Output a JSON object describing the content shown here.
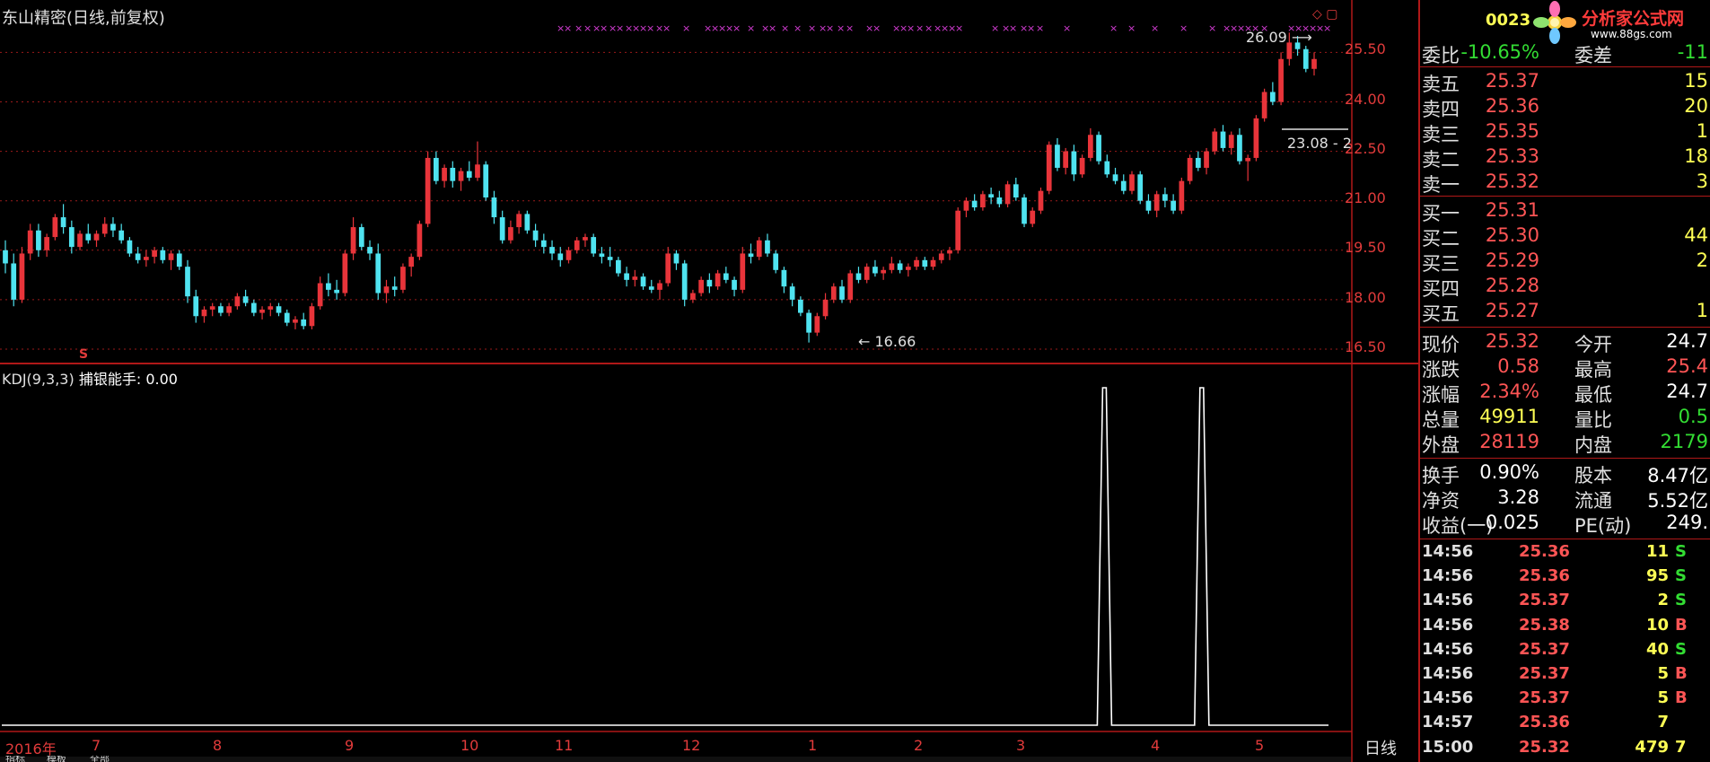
{
  "header": {
    "title": "东山精密(日线,前复权)",
    "code": "0023",
    "logo_text": "分析家公式网",
    "logo_url": "www.88gs.com"
  },
  "indicator": {
    "name": "KDJ(9,3,3)",
    "label": "捕银能手:",
    "value": "0.00"
  },
  "axis": {
    "price_ticks": [
      "25.50",
      "24.00",
      "22.50",
      "21.00",
      "19.50",
      "18.00",
      "16.50"
    ],
    "year": "2016年",
    "months": [
      "7",
      "8",
      "9",
      "10",
      "11",
      "12",
      "1",
      "2",
      "3",
      "4",
      "5"
    ],
    "period_label": "日线"
  },
  "annotations": {
    "high": "26.09",
    "low": "16.66",
    "range": "23.08 - 2",
    "signal_marker": "S"
  },
  "bottom_tabs": [
    "指标",
    "模板",
    "全部"
  ],
  "order_book": {
    "ratio": {
      "label": "委比",
      "value": "-10.65%",
      "label2": "委差",
      "value2": "-11"
    },
    "asks": [
      {
        "label": "卖五",
        "price": "25.37",
        "vol": "15"
      },
      {
        "label": "卖四",
        "price": "25.36",
        "vol": "20"
      },
      {
        "label": "卖三",
        "price": "25.35",
        "vol": "1"
      },
      {
        "label": "卖二",
        "price": "25.33",
        "vol": "18"
      },
      {
        "label": "卖一",
        "price": "25.32",
        "vol": "3"
      }
    ],
    "bids": [
      {
        "label": "买一",
        "price": "25.31",
        "vol": ""
      },
      {
        "label": "买二",
        "price": "25.30",
        "vol": "44"
      },
      {
        "label": "买三",
        "price": "25.29",
        "vol": "2"
      },
      {
        "label": "买四",
        "price": "25.28",
        "vol": ""
      },
      {
        "label": "买五",
        "price": "25.27",
        "vol": "1"
      }
    ]
  },
  "quote": [
    {
      "l1": "现价",
      "v1": "25.32",
      "l2": "今开",
      "v2": "24.7"
    },
    {
      "l1": "涨跌",
      "v1": "0.58",
      "l2": "最高",
      "v2": "25.4"
    },
    {
      "l1": "涨幅",
      "v1": "2.34%",
      "l2": "最低",
      "v2": "24.7"
    },
    {
      "l1": "总量",
      "v1": "49911",
      "l2": "量比",
      "v2": "0.5"
    },
    {
      "l1": "外盘",
      "v1": "28119",
      "l2": "内盘",
      "v2": "2179"
    }
  ],
  "fundamentals": [
    {
      "l1": "换手",
      "v1": "0.90%",
      "l2": "股本",
      "v2": "8.47亿"
    },
    {
      "l1": "净资",
      "v1": "3.28",
      "l2": "流通",
      "v2": "5.52亿"
    },
    {
      "l1": "收益(一)",
      "v1": "0.025",
      "l2": "PE(动)",
      "v2": "249."
    }
  ],
  "ticks": [
    {
      "time": "14:56",
      "price": "25.36",
      "vol": "11",
      "side": "S"
    },
    {
      "time": "14:56",
      "price": "25.36",
      "vol": "95",
      "side": "S"
    },
    {
      "time": "14:56",
      "price": "25.37",
      "vol": "2",
      "side": "S"
    },
    {
      "time": "14:56",
      "price": "25.38",
      "vol": "10",
      "side": "B"
    },
    {
      "time": "14:56",
      "price": "25.37",
      "vol": "40",
      "side": "S"
    },
    {
      "time": "14:56",
      "price": "25.37",
      "vol": "5",
      "side": "B"
    },
    {
      "time": "14:56",
      "price": "25.37",
      "vol": "5",
      "side": "B"
    },
    {
      "time": "14:57",
      "price": "25.36",
      "vol": "7",
      "side": ""
    },
    {
      "time": "15:00",
      "price": "25.32",
      "vol": "479",
      "side": "7"
    }
  ],
  "colors": {
    "up": "#e8343a",
    "down": "#4fe3f0",
    "grid": "#b01818",
    "text": "#e0e0e0",
    "marker": "#d43cd4"
  },
  "chart_data": {
    "type": "candlestick",
    "ylim": [
      16.2,
      26.6
    ],
    "ohlc": [
      [
        19.5,
        19.8,
        18.8,
        19.1
      ],
      [
        19.1,
        19.4,
        17.8,
        18.0
      ],
      [
        18.0,
        19.6,
        17.9,
        19.4
      ],
      [
        19.4,
        20.3,
        19.2,
        20.1
      ],
      [
        20.1,
        20.3,
        19.3,
        19.5
      ],
      [
        19.5,
        20.0,
        19.3,
        19.9
      ],
      [
        19.9,
        20.6,
        19.8,
        20.5
      ],
      [
        20.5,
        20.9,
        20.0,
        20.2
      ],
      [
        20.2,
        20.4,
        19.4,
        19.6
      ],
      [
        19.6,
        20.1,
        19.5,
        20.0
      ],
      [
        20.0,
        20.3,
        19.7,
        19.8
      ],
      [
        19.8,
        20.1,
        19.6,
        20.0
      ],
      [
        20.0,
        20.5,
        19.9,
        20.3
      ],
      [
        20.3,
        20.5,
        19.9,
        20.1
      ],
      [
        20.1,
        20.3,
        19.7,
        19.8
      ],
      [
        19.8,
        19.9,
        19.3,
        19.4
      ],
      [
        19.4,
        19.6,
        19.1,
        19.2
      ],
      [
        19.2,
        19.5,
        19.0,
        19.3
      ],
      [
        19.3,
        19.6,
        19.1,
        19.5
      ],
      [
        19.5,
        19.6,
        19.1,
        19.2
      ],
      [
        19.2,
        19.5,
        18.9,
        19.4
      ],
      [
        19.4,
        19.5,
        18.9,
        19.0
      ],
      [
        19.0,
        19.2,
        17.9,
        18.1
      ],
      [
        18.1,
        18.3,
        17.3,
        17.5
      ],
      [
        17.5,
        17.8,
        17.3,
        17.7
      ],
      [
        17.7,
        17.9,
        17.5,
        17.8
      ],
      [
        17.8,
        17.9,
        17.5,
        17.6
      ],
      [
        17.6,
        17.9,
        17.5,
        17.8
      ],
      [
        17.8,
        18.2,
        17.7,
        18.1
      ],
      [
        18.1,
        18.3,
        17.8,
        17.9
      ],
      [
        17.9,
        18.0,
        17.5,
        17.6
      ],
      [
        17.6,
        17.8,
        17.4,
        17.7
      ],
      [
        17.7,
        17.9,
        17.5,
        17.8
      ],
      [
        17.8,
        17.9,
        17.5,
        17.6
      ],
      [
        17.6,
        17.7,
        17.2,
        17.3
      ],
      [
        17.3,
        17.5,
        17.1,
        17.4
      ],
      [
        17.4,
        17.6,
        17.1,
        17.2
      ],
      [
        17.2,
        17.9,
        17.1,
        17.8
      ],
      [
        17.8,
        18.7,
        17.7,
        18.5
      ],
      [
        18.5,
        18.8,
        18.1,
        18.3
      ],
      [
        18.3,
        18.6,
        18.0,
        18.2
      ],
      [
        18.2,
        19.5,
        18.1,
        19.4
      ],
      [
        19.4,
        20.5,
        19.2,
        20.2
      ],
      [
        20.2,
        20.3,
        19.5,
        19.6
      ],
      [
        19.6,
        19.8,
        19.2,
        19.4
      ],
      [
        19.4,
        19.7,
        18.0,
        18.2
      ],
      [
        18.2,
        18.6,
        17.9,
        18.4
      ],
      [
        18.4,
        18.7,
        18.1,
        18.3
      ],
      [
        18.3,
        19.1,
        18.2,
        19.0
      ],
      [
        19.0,
        19.4,
        18.7,
        19.3
      ],
      [
        19.3,
        20.4,
        19.2,
        20.3
      ],
      [
        20.3,
        22.5,
        20.2,
        22.3
      ],
      [
        22.3,
        22.5,
        21.5,
        21.6
      ],
      [
        21.6,
        22.1,
        21.4,
        22.0
      ],
      [
        22.0,
        22.2,
        21.4,
        21.6
      ],
      [
        21.6,
        22.0,
        21.3,
        21.9
      ],
      [
        21.9,
        22.2,
        21.6,
        21.7
      ],
      [
        21.7,
        22.8,
        21.6,
        22.1
      ],
      [
        22.1,
        22.2,
        21.0,
        21.1
      ],
      [
        21.1,
        21.3,
        20.3,
        20.5
      ],
      [
        20.5,
        20.7,
        19.7,
        19.8
      ],
      [
        19.8,
        20.4,
        19.7,
        20.2
      ],
      [
        20.2,
        20.7,
        20.0,
        20.6
      ],
      [
        20.6,
        20.7,
        20.0,
        20.1
      ],
      [
        20.1,
        20.3,
        19.6,
        19.8
      ],
      [
        19.8,
        20.0,
        19.4,
        19.6
      ],
      [
        19.6,
        19.8,
        19.2,
        19.4
      ],
      [
        19.4,
        19.6,
        19.0,
        19.2
      ],
      [
        19.2,
        19.6,
        19.1,
        19.5
      ],
      [
        19.5,
        19.9,
        19.4,
        19.8
      ],
      [
        19.8,
        20.0,
        19.6,
        19.9
      ],
      [
        19.9,
        20.0,
        19.3,
        19.4
      ],
      [
        19.4,
        19.6,
        19.1,
        19.3
      ],
      [
        19.3,
        19.6,
        19.0,
        19.2
      ],
      [
        19.2,
        19.3,
        18.7,
        18.8
      ],
      [
        18.8,
        19.0,
        18.4,
        18.6
      ],
      [
        18.6,
        18.9,
        18.4,
        18.7
      ],
      [
        18.7,
        18.8,
        18.3,
        18.4
      ],
      [
        18.4,
        18.6,
        18.2,
        18.3
      ],
      [
        18.3,
        18.6,
        18.0,
        18.5
      ],
      [
        18.5,
        19.6,
        18.4,
        19.4
      ],
      [
        19.4,
        19.5,
        18.9,
        19.1
      ],
      [
        19.1,
        19.2,
        17.8,
        18.0
      ],
      [
        18.0,
        18.3,
        17.9,
        18.2
      ],
      [
        18.2,
        18.7,
        18.1,
        18.6
      ],
      [
        18.6,
        18.8,
        18.2,
        18.4
      ],
      [
        18.4,
        18.9,
        18.3,
        18.8
      ],
      [
        18.8,
        19.0,
        18.5,
        18.6
      ],
      [
        18.6,
        18.7,
        18.1,
        18.3
      ],
      [
        18.3,
        19.6,
        18.2,
        19.4
      ],
      [
        19.4,
        19.7,
        19.1,
        19.3
      ],
      [
        19.3,
        19.9,
        19.2,
        19.8
      ],
      [
        19.8,
        20.0,
        19.3,
        19.4
      ],
      [
        19.4,
        19.5,
        18.8,
        18.9
      ],
      [
        18.9,
        19.0,
        18.2,
        18.4
      ],
      [
        18.4,
        18.5,
        17.8,
        18.0
      ],
      [
        18.0,
        18.1,
        17.5,
        17.6
      ],
      [
        17.6,
        17.7,
        16.7,
        17.0
      ],
      [
        17.0,
        17.6,
        16.9,
        17.5
      ],
      [
        17.5,
        18.2,
        17.4,
        18.0
      ],
      [
        18.0,
        18.5,
        17.9,
        18.4
      ],
      [
        18.4,
        18.6,
        17.9,
        18.0
      ],
      [
        18.0,
        18.9,
        17.9,
        18.8
      ],
      [
        18.8,
        19.0,
        18.5,
        18.6
      ],
      [
        18.6,
        19.1,
        18.5,
        19.0
      ],
      [
        19.0,
        19.2,
        18.7,
        18.8
      ],
      [
        18.8,
        19.0,
        18.6,
        18.9
      ],
      [
        18.9,
        19.3,
        18.8,
        19.1
      ],
      [
        19.1,
        19.2,
        18.8,
        18.9
      ],
      [
        18.9,
        19.1,
        18.7,
        19.0
      ],
      [
        19.0,
        19.3,
        18.9,
        19.2
      ],
      [
        19.2,
        19.3,
        18.9,
        19.0
      ],
      [
        19.0,
        19.3,
        18.9,
        19.2
      ],
      [
        19.2,
        19.5,
        19.1,
        19.4
      ],
      [
        19.4,
        19.6,
        19.2,
        19.5
      ],
      [
        19.5,
        20.8,
        19.4,
        20.7
      ],
      [
        20.7,
        21.1,
        20.5,
        21.0
      ],
      [
        21.0,
        21.2,
        20.7,
        20.8
      ],
      [
        20.8,
        21.3,
        20.7,
        21.2
      ],
      [
        21.2,
        21.4,
        20.9,
        21.1
      ],
      [
        21.1,
        21.3,
        20.8,
        20.9
      ],
      [
        20.9,
        21.6,
        20.8,
        21.5
      ],
      [
        21.5,
        21.7,
        21.0,
        21.1
      ],
      [
        21.1,
        21.2,
        20.2,
        20.3
      ],
      [
        20.3,
        20.8,
        20.2,
        20.7
      ],
      [
        20.7,
        21.4,
        20.6,
        21.3
      ],
      [
        21.3,
        22.8,
        21.2,
        22.7
      ],
      [
        22.7,
        22.9,
        21.9,
        22.0
      ],
      [
        22.0,
        22.6,
        21.8,
        22.5
      ],
      [
        22.5,
        22.7,
        21.6,
        21.8
      ],
      [
        21.8,
        22.4,
        21.7,
        22.3
      ],
      [
        22.3,
        23.2,
        22.2,
        23.0
      ],
      [
        23.0,
        23.1,
        22.1,
        22.2
      ],
      [
        22.2,
        22.4,
        21.7,
        21.8
      ],
      [
        21.8,
        22.0,
        21.5,
        21.6
      ],
      [
        21.6,
        21.8,
        21.2,
        21.3
      ],
      [
        21.3,
        21.9,
        21.2,
        21.8
      ],
      [
        21.8,
        21.9,
        20.9,
        21.0
      ],
      [
        21.0,
        21.2,
        20.6,
        20.7
      ],
      [
        20.7,
        21.3,
        20.5,
        21.2
      ],
      [
        21.2,
        21.4,
        20.8,
        21.0
      ],
      [
        21.0,
        21.2,
        20.6,
        20.7
      ],
      [
        20.7,
        21.7,
        20.6,
        21.6
      ],
      [
        21.6,
        22.4,
        21.5,
        22.3
      ],
      [
        22.3,
        22.5,
        21.9,
        22.0
      ],
      [
        22.0,
        22.6,
        21.8,
        22.5
      ],
      [
        22.5,
        23.2,
        22.4,
        23.1
      ],
      [
        23.1,
        23.3,
        22.5,
        22.6
      ],
      [
        22.6,
        23.1,
        22.4,
        23.0
      ],
      [
        23.0,
        23.2,
        22.1,
        22.2
      ],
      [
        22.2,
        22.4,
        21.6,
        22.3
      ],
      [
        22.3,
        23.6,
        22.2,
        23.5
      ],
      [
        23.5,
        24.4,
        23.4,
        24.3
      ],
      [
        24.3,
        24.6,
        23.9,
        24.0
      ],
      [
        24.0,
        25.5,
        23.9,
        25.3
      ],
      [
        25.3,
        26.1,
        25.1,
        25.8
      ],
      [
        25.8,
        26.0,
        25.4,
        25.6
      ],
      [
        25.6,
        25.7,
        24.9,
        25.0
      ],
      [
        25.0,
        25.5,
        24.8,
        25.3
      ]
    ],
    "kdj_signal": {
      "spike_indices": [
        68,
        74
      ],
      "spike_value": 1,
      "baseline": 0
    }
  }
}
